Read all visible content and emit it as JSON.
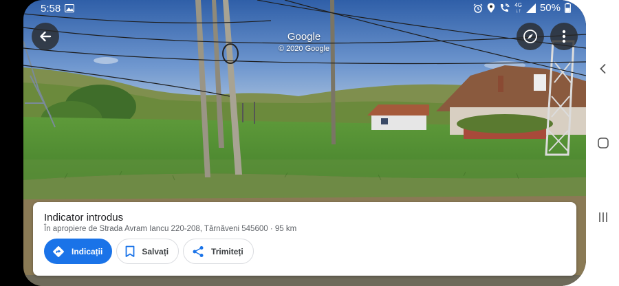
{
  "status_bar": {
    "time": "5:58",
    "network_top": "4G",
    "network_bottom": "↓↑",
    "battery": "50%"
  },
  "top_bar": {
    "title": "Google",
    "copyright": "© 2020 Google"
  },
  "card": {
    "title": "Indicator introdus",
    "subtitle": "În apropiere de Strada Avram Iancu 220-208, Târnăveni 545600 · 95 km",
    "actions": [
      {
        "label": "Indicații",
        "icon": "directions-icon"
      },
      {
        "label": "Salvați",
        "icon": "bookmark-icon"
      },
      {
        "label": "Trimiteți",
        "icon": "share-icon"
      }
    ]
  },
  "colors": {
    "primary_blue": "#1a73e8",
    "overlay_button": "#282828"
  },
  "icons": [
    "back-arrow-icon",
    "compass-icon",
    "more-vert-icon",
    "nav-back-icon",
    "nav-home-icon",
    "nav-recents-icon"
  ]
}
